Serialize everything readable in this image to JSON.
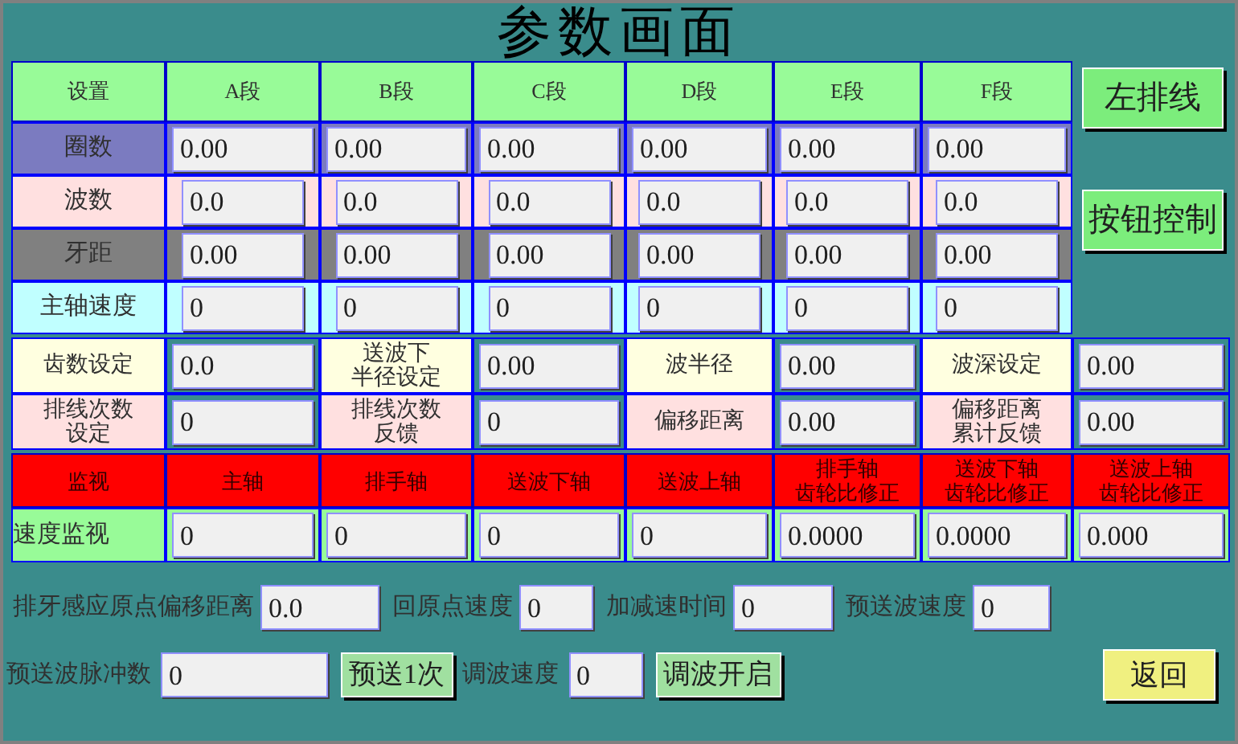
{
  "title": "参数画面",
  "header": [
    "设置",
    "A段",
    "B段",
    "C段",
    "D段",
    "E段",
    "F段"
  ],
  "param_rows": [
    {
      "label": "圈数",
      "color": "#7b7bc0",
      "values": [
        "0.00",
        "0.00",
        "0.00",
        "0.00",
        "0.00",
        "0.00"
      ]
    },
    {
      "label": "波数",
      "color": "#ffe0e0",
      "values": [
        "0.0",
        "0.0",
        "0.0",
        "0.0",
        "0.0",
        "0.0"
      ]
    },
    {
      "label": "牙距",
      "color": "#808080",
      "values": [
        "0.00",
        "0.00",
        "0.00",
        "0.00",
        "0.00",
        "0.00"
      ]
    },
    {
      "label": "主轴速度",
      "color": "#c0ffff",
      "values": [
        "0",
        "0",
        "0",
        "0",
        "0",
        "0"
      ]
    }
  ],
  "side_buttons": [
    "左排线",
    "按钮控制"
  ],
  "settings_rows": [
    {
      "color": "#ffffe0",
      "pairs": [
        {
          "label": [
            "齿数设定"
          ],
          "value": "0.0"
        },
        {
          "label": [
            "送波下",
            "半径设定"
          ],
          "value": "0.00"
        },
        {
          "label": [
            "波半径"
          ],
          "value": "0.00"
        },
        {
          "label": [
            "波深设定"
          ],
          "value": "0.00"
        }
      ]
    },
    {
      "color": "#ffe0e0",
      "pairs": [
        {
          "label": [
            "排线次数",
            "设定"
          ],
          "value": "0"
        },
        {
          "label": [
            "排线次数",
            "反馈"
          ],
          "value": "0"
        },
        {
          "label": [
            "偏移距离"
          ],
          "value": "0.00"
        },
        {
          "label": [
            "偏移距离",
            "累计反馈"
          ],
          "value": "0.00"
        }
      ]
    }
  ],
  "monitor": {
    "header": [
      [
        "监视"
      ],
      [
        "主轴"
      ],
      [
        "排手轴"
      ],
      [
        "送波下轴"
      ],
      [
        "送波上轴"
      ],
      [
        "排手轴",
        "齿轮比修正"
      ],
      [
        "送波下轴",
        "齿轮比修正"
      ],
      [
        "送波上轴",
        "齿轮比修正"
      ]
    ],
    "row_label": "速度监视",
    "values": [
      "0",
      "0",
      "0",
      "0",
      "0.0000",
      "0.0000",
      "0.000"
    ]
  },
  "bottom_row_1": [
    {
      "label": "排牙感应原点偏移距离",
      "value": "0.0"
    },
    {
      "label": "回原点速度",
      "value": "0"
    },
    {
      "label": "加减速时间",
      "value": "0"
    },
    {
      "label": "预送波速度",
      "value": "0"
    }
  ],
  "bottom_row_2": [
    {
      "kind": "field",
      "label": "预送波脉冲数",
      "value": "0"
    },
    {
      "kind": "button",
      "label": "预送1次"
    },
    {
      "kind": "field",
      "label": "调波速度",
      "value": "0"
    },
    {
      "kind": "button",
      "label": "调波开启"
    }
  ],
  "back_button": "返回"
}
